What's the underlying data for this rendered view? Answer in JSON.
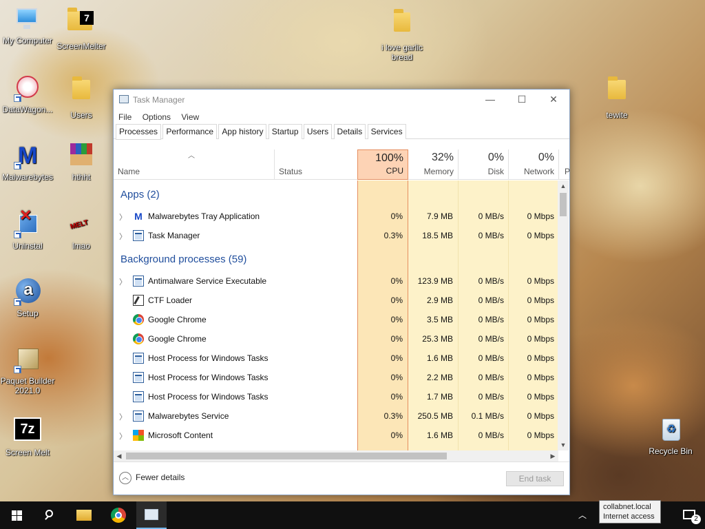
{
  "desktop": {
    "icons": [
      {
        "label": "My Computer"
      },
      {
        "label": "ScreenMelter"
      },
      {
        "label": "i love garlic bread"
      },
      {
        "label": "DataWagon..."
      },
      {
        "label": "Users"
      },
      {
        "label": "tewite"
      },
      {
        "label": "Malwarebytes"
      },
      {
        "label": "hthht"
      },
      {
        "label": "Uninstal"
      },
      {
        "label": "lmao"
      },
      {
        "label": "Setup"
      },
      {
        "label": "Paquet Builder 2021.0"
      },
      {
        "label": "Screen Melt"
      },
      {
        "label": "Recycle Bin"
      }
    ]
  },
  "window": {
    "title": "Task Manager",
    "menu": [
      "File",
      "Options",
      "View"
    ],
    "tabs": [
      "Processes",
      "Performance",
      "App history",
      "Startup",
      "Users",
      "Details",
      "Services"
    ],
    "active_tab": "Processes",
    "columns": {
      "name": "Name",
      "status": "Status",
      "cpu": {
        "pct": "100%",
        "label": "CPU"
      },
      "memory": {
        "pct": "32%",
        "label": "Memory"
      },
      "disk": {
        "pct": "0%",
        "label": "Disk"
      },
      "network": {
        "pct": "0%",
        "label": "Network"
      },
      "power": "P"
    },
    "groups": {
      "apps": "Apps (2)",
      "background": "Background processes (59)"
    },
    "apps": [
      {
        "name": "Malwarebytes Tray Application",
        "cpu": "0%",
        "mem": "7.9 MB",
        "disk": "0 MB/s",
        "net": "0 Mbps",
        "icon": "malwarebytes-icon"
      },
      {
        "name": "Task Manager",
        "cpu": "0.3%",
        "mem": "18.5 MB",
        "disk": "0 MB/s",
        "net": "0 Mbps",
        "icon": "task-manager-icon"
      }
    ],
    "background": [
      {
        "name": "Antimalware Service Executable",
        "cpu": "0%",
        "mem": "123.9 MB",
        "disk": "0 MB/s",
        "net": "0 Mbps",
        "icon": "service-icon"
      },
      {
        "name": "CTF Loader",
        "cpu": "0%",
        "mem": "2.9 MB",
        "disk": "0 MB/s",
        "net": "0 Mbps",
        "icon": "ctf-icon"
      },
      {
        "name": "Google Chrome",
        "cpu": "0%",
        "mem": "3.5 MB",
        "disk": "0 MB/s",
        "net": "0 Mbps",
        "icon": "chrome-icon"
      },
      {
        "name": "Google Chrome",
        "cpu": "0%",
        "mem": "25.3 MB",
        "disk": "0 MB/s",
        "net": "0 Mbps",
        "icon": "chrome-icon"
      },
      {
        "name": "Host Process for Windows Tasks",
        "cpu": "0%",
        "mem": "1.6 MB",
        "disk": "0 MB/s",
        "net": "0 Mbps",
        "icon": "service-icon"
      },
      {
        "name": "Host Process for Windows Tasks",
        "cpu": "0%",
        "mem": "2.2 MB",
        "disk": "0 MB/s",
        "net": "0 Mbps",
        "icon": "service-icon"
      },
      {
        "name": "Host Process for Windows Tasks",
        "cpu": "0%",
        "mem": "1.7 MB",
        "disk": "0 MB/s",
        "net": "0 Mbps",
        "icon": "service-icon"
      },
      {
        "name": "Malwarebytes Service",
        "cpu": "0.3%",
        "mem": "250.5 MB",
        "disk": "0.1 MB/s",
        "net": "0 Mbps",
        "icon": "service-icon"
      },
      {
        "name": "Microsoft Content",
        "cpu": "0%",
        "mem": "1.6 MB",
        "disk": "0 MB/s",
        "net": "0 Mbps",
        "icon": "microsoft-icon"
      }
    ],
    "footer": {
      "fewer_details": "Fewer details",
      "end_task": "End task"
    }
  },
  "taskbar": {
    "tooltip": {
      "line1": "collabnet.local",
      "line2": "Internet access"
    },
    "notification_count": "2"
  }
}
